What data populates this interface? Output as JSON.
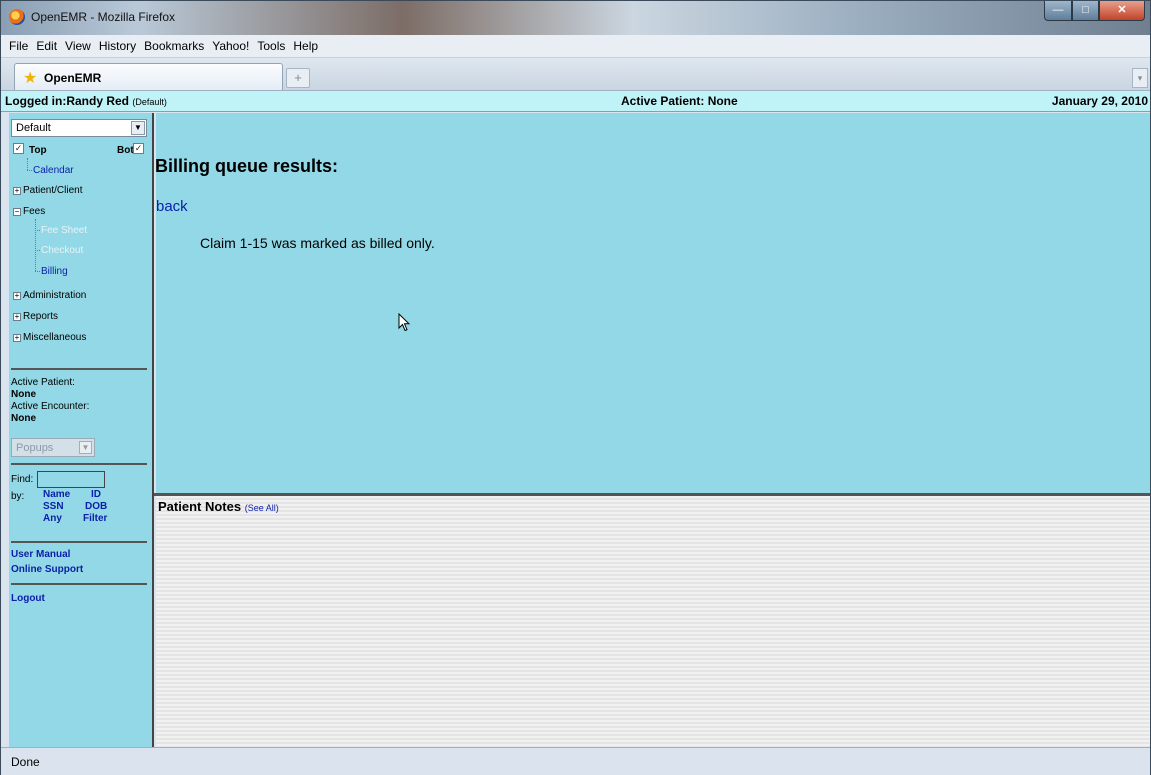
{
  "window": {
    "title": "OpenEMR - Mozilla Firefox"
  },
  "menubar": [
    "File",
    "Edit",
    "View",
    "History",
    "Bookmarks",
    "Yahoo!",
    "Tools",
    "Help"
  ],
  "tabs": [
    {
      "label": "OpenEMR"
    }
  ],
  "newtab_glyph": "+",
  "header": {
    "logged_in": "Logged in:Randy Red",
    "login_mode": "(Default)",
    "active_patient": "Active Patient: None",
    "date": "January 29, 2010"
  },
  "nav": {
    "layout_select": "Default",
    "top_label": "Top",
    "bot_label": "Bot",
    "calendar": "Calendar",
    "patient_client": "Patient/Client",
    "fees": "Fees",
    "fee_sheet": "Fee Sheet",
    "checkout": "Checkout",
    "billing": "Billing",
    "administration": "Administration",
    "reports": "Reports",
    "miscellaneous": "Miscellaneous",
    "active_patient_label": "Active Patient:",
    "active_patient_value": "None",
    "active_encounter_label": "Active Encounter:",
    "active_encounter_value": "None",
    "popups": "Popups",
    "find_label": "Find:",
    "by_label": "by:",
    "find_name": "Name",
    "find_id": "ID",
    "find_ssn": "SSN",
    "find_dob": "DOB",
    "find_any": "Any",
    "find_filter": "Filter",
    "user_manual": "User Manual",
    "online_support": "Online Support",
    "logout": "Logout"
  },
  "main": {
    "heading": "Billing queue results:",
    "back": "back",
    "message": "Claim 1-15 was marked as billed only."
  },
  "notes": {
    "title": "Patient Notes",
    "see_all": "(See All)"
  },
  "status": "Done"
}
